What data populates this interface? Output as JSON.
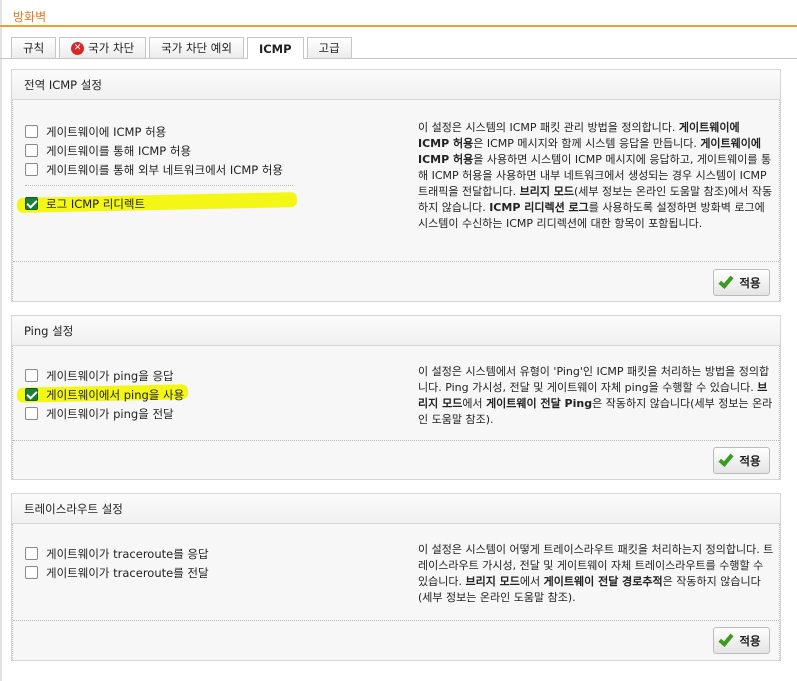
{
  "page": {
    "title": "방화벽"
  },
  "tabs": [
    {
      "label": "규칙"
    },
    {
      "label": "국가 차단",
      "icon": "error-x-icon"
    },
    {
      "label": "국가 차단 예외"
    },
    {
      "label": "ICMP",
      "active": true
    },
    {
      "label": "고급"
    }
  ],
  "apply_label": "적용",
  "colors": {
    "accent": "#e8771e",
    "highlight": "#f4f716",
    "check": "#1b7f36"
  },
  "sections": {
    "icmp": {
      "title": "전역 ICMP 설정",
      "options": [
        {
          "label": "게이트웨이에 ICMP 허용",
          "checked": false
        },
        {
          "label": "게이트웨이를 통해 ICMP 허용",
          "checked": false
        },
        {
          "label": "게이트웨이를 통해 외부 네트워크에서 ICMP 허용",
          "checked": false
        },
        {
          "label": "로그 ICMP 리디렉트",
          "checked": true
        }
      ],
      "desc": [
        "이 설정은 시스템의 ICMP 패킷 관리 방법을 정의합니다. ",
        "게이트웨이에 ICMP 허용",
        "은 ICMP 메시지와 함께 시스템 응답을 만듭니다. ",
        "게이트웨이에 ICMP 허용",
        "을 사용하면 시스템이 ICMP 메시지에 응답하고, 게이트웨이를 통해 ICMP 허용을 사용하면 내부 네트워크에서 생성되는 경우 시스템이 ICMP 트래픽을 전달합니다. ",
        "브리지 모드",
        "(세부 정보는 온라인 도움말 참조)에서 작동하지 않습니다. ",
        "ICMP 리디렉션 로그",
        "를 사용하도록 설정하면 방화벽 로그에 시스템이 수신하는 ICMP 리디렉션에 대한 항목이 포함됩니다."
      ]
    },
    "ping": {
      "title": "Ping 설정",
      "options": [
        {
          "label": "게이트웨이가 ping을 응답",
          "checked": false
        },
        {
          "label": "게이트웨이에서 ping을 사용",
          "checked": true
        },
        {
          "label": "게이트웨이가 ping을 전달",
          "checked": false
        }
      ],
      "desc": [
        "이 설정은 시스템에서 유형이 'Ping'인 ICMP 패킷을 처리하는 방법을 정의합니다. Ping 가시성, 전달 및 게이트웨이 자체 ping을 수행할 수 있습니다. ",
        "브리지 모드",
        "에서 ",
        "게이트웨이 전달 Ping",
        "은 작동하지 않습니다(세부 정보는 온라인 도움말 참조)."
      ]
    },
    "traceroute": {
      "title": "트레이스라우트 설정",
      "options": [
        {
          "label": "게이트웨이가 traceroute를 응답",
          "checked": false
        },
        {
          "label": "게이트웨이가 traceroute를 전달",
          "checked": false
        }
      ],
      "desc": [
        "이 설정은 시스템이 어떻게 트레이스라우트 패킷을 처리하는지 정의합니다. 트레이스라우트 가시성, 전달 및 게이트웨이 자체 트레이스라우트를 수행할 수 있습니다. ",
        "브리지 모드",
        "에서 ",
        "게이트웨이 전달 경로추적",
        "은 작동하지 않습니다(세부 정보는 온라인 도움말 참조)."
      ]
    }
  }
}
